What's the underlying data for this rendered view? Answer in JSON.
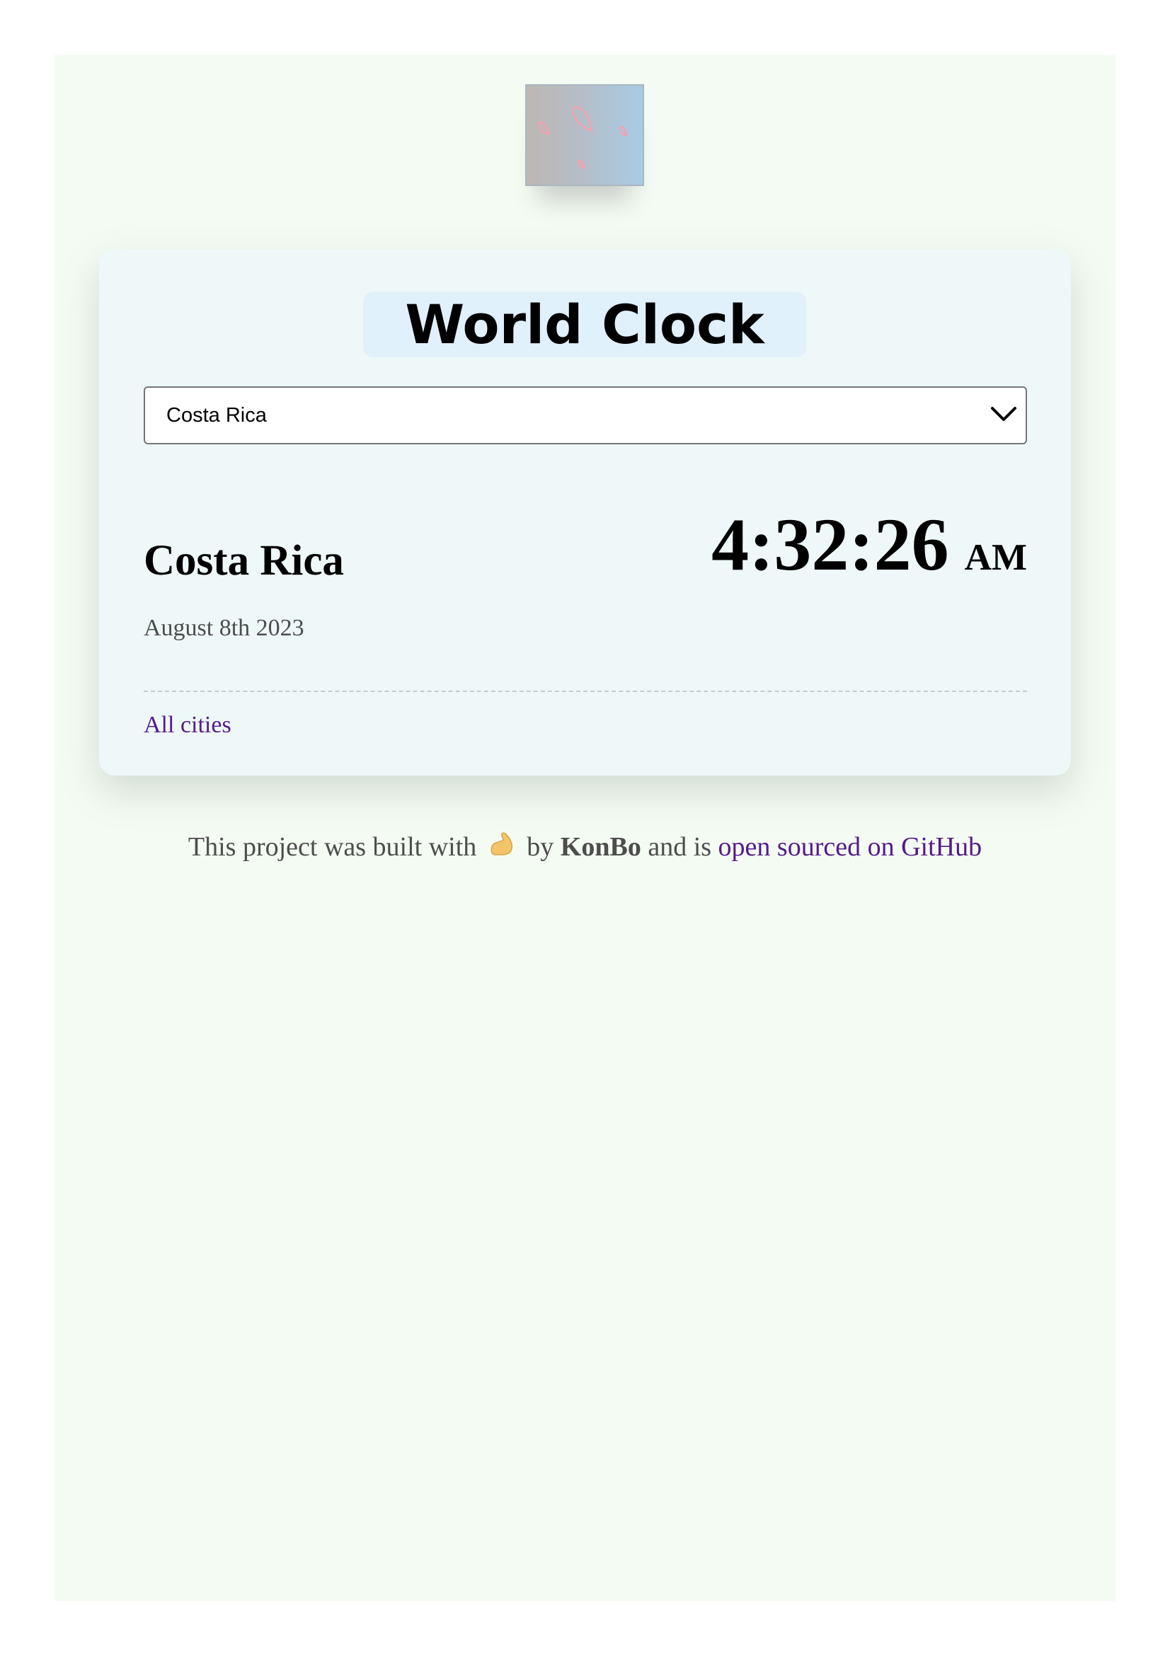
{
  "header": {
    "logo_icon": "raindrops-logo-icon"
  },
  "card": {
    "title": "World Clock",
    "select": {
      "selected": "Costa Rica",
      "icon": "chevron-down-icon"
    },
    "city_name": "Costa Rica",
    "time": "4:32:26",
    "ampm": "AM",
    "date": "August 8th 2023",
    "all_cities_link": "All cities"
  },
  "footer": {
    "prefix": "This project was built with",
    "emoji_icon": "flexed-biceps-icon",
    "by": "by",
    "author": "KonBo",
    "middle": "and is",
    "link_text": "open sourced on GitHub"
  },
  "colors": {
    "page_bg": "#f4fbf3",
    "card_bg": "#eef8f8",
    "title_pill": "#e1f1fb",
    "link": "#551a8b",
    "muted_text": "#4d4d4d"
  }
}
